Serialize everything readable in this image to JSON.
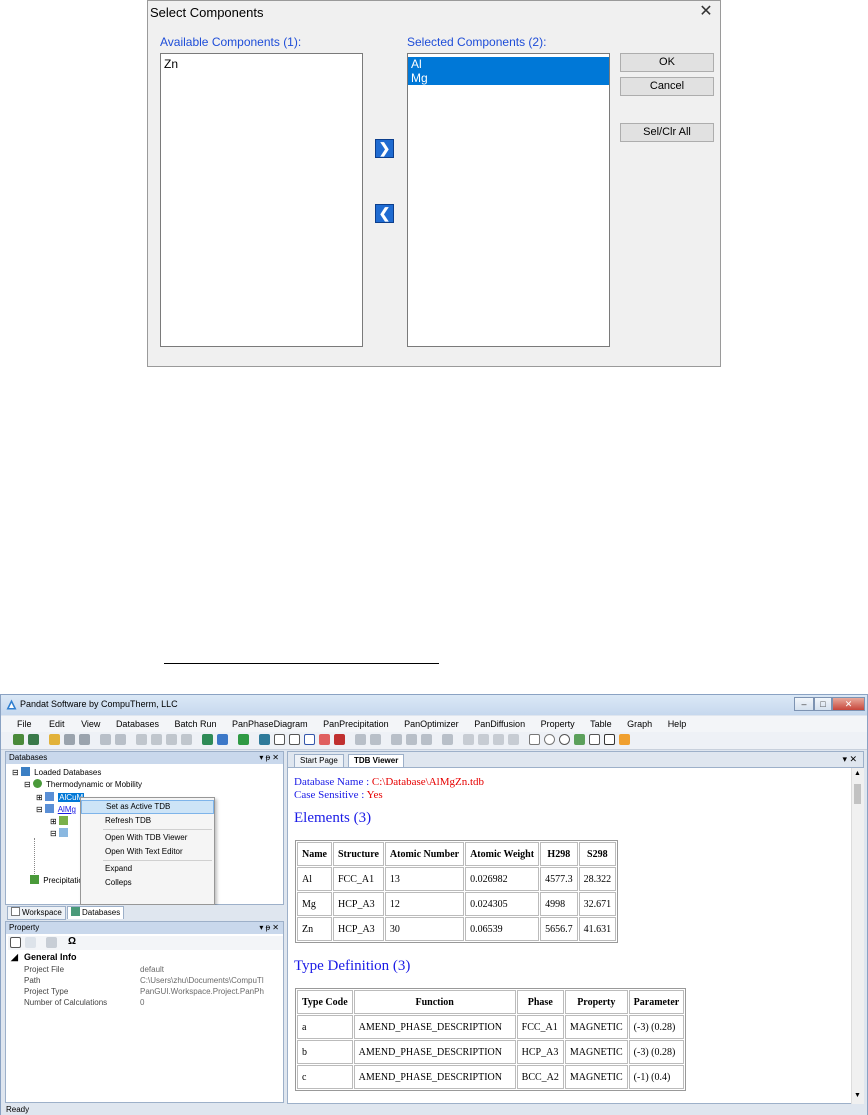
{
  "dialog": {
    "title": "Select Components",
    "available_label": "Available Components (1):",
    "selected_label": "Selected Components (2):",
    "available_items": [
      "Zn"
    ],
    "selected_items": [
      "Al",
      "Mg"
    ],
    "buttons": {
      "ok": "OK",
      "cancel": "Cancel",
      "sel_clr_all": "Sel/Clr All"
    },
    "move_right_glyph": "❯",
    "move_left_glyph": "❮"
  },
  "window": {
    "title": "Pandat Software by CompuTherm, LLC",
    "menu": [
      "File",
      "Edit",
      "View",
      "Databases",
      "Batch Run",
      "PanPhaseDiagram",
      "PanPrecipitation",
      "PanOptimizer",
      "PanDiffusion",
      "Property",
      "Table",
      "Graph",
      "Help"
    ],
    "databases_pane": {
      "header": "Databases",
      "tree": {
        "root": "Loaded Databases",
        "group": "Thermodynamic or Mobility",
        "item1": "AlCuM",
        "item2": "AlMg",
        "item3": "Precipitation"
      }
    },
    "context_menu": [
      "Set as Active TDB",
      "Refresh TDB",
      "Open With TDB Viewer",
      "Open With Text Editor",
      "Expand",
      "Colleps"
    ],
    "left_tabs": [
      "Workspace",
      "Databases"
    ],
    "property_pane": {
      "header": "Property",
      "section": "General Info",
      "rows": [
        {
          "key": "Project File",
          "value": "default"
        },
        {
          "key": "Path",
          "value": "C:\\Users\\zhu\\Documents\\CompuTl"
        },
        {
          "key": "Project Type",
          "value": "PanGUI.Workspace.Project.PanPh"
        },
        {
          "key": "Number of Calculations",
          "value": "0"
        }
      ]
    },
    "doc_tabs": [
      "Start Page",
      "TDB Viewer"
    ],
    "tdb": {
      "db_name_label": "Database Name : ",
      "db_name_value": "C:\\Database\\AlMgZn.tdb",
      "case_label": "Case Sensitive : ",
      "case_value": "Yes",
      "elements_heading": "Elements (3)",
      "elements_headers": [
        "Name",
        "Structure",
        "Atomic Number",
        "Atomic Weight",
        "H298",
        "S298"
      ],
      "elements_rows": [
        [
          "Al",
          "FCC_A1",
          "13",
          "0.026982",
          "4577.3",
          "28.322"
        ],
        [
          "Mg",
          "HCP_A3",
          "12",
          "0.024305",
          "4998",
          "32.671"
        ],
        [
          "Zn",
          "HCP_A3",
          "30",
          "0.06539",
          "5656.7",
          "41.631"
        ]
      ],
      "type_heading": "Type Definition (3)",
      "type_headers": [
        "Type Code",
        "Function",
        "Phase",
        "Property",
        "Parameter"
      ],
      "type_rows": [
        [
          "a",
          "AMEND_PHASE_DESCRIPTION",
          "FCC_A1",
          "MAGNETIC",
          "(-3) (0.28)"
        ],
        [
          "b",
          "AMEND_PHASE_DESCRIPTION",
          "HCP_A3",
          "MAGNETIC",
          "(-3) (0.28)"
        ],
        [
          "c",
          "AMEND_PHASE_DESCRIPTION",
          "BCC_A2",
          "MAGNETIC",
          "(-1) (0.4)"
        ]
      ]
    },
    "status": "Ready",
    "window_controls": {
      "minimize": "–",
      "maximize": "□",
      "close": "✕"
    },
    "pane_controls": "▾ ᵽ ✕",
    "doc_controls": "▾ ✕",
    "colors": {
      "dialog_label": "#1e4dd8",
      "selection": "#0078d7",
      "heading_blue": "#1a1ae6",
      "value_red": "#e60000"
    }
  }
}
